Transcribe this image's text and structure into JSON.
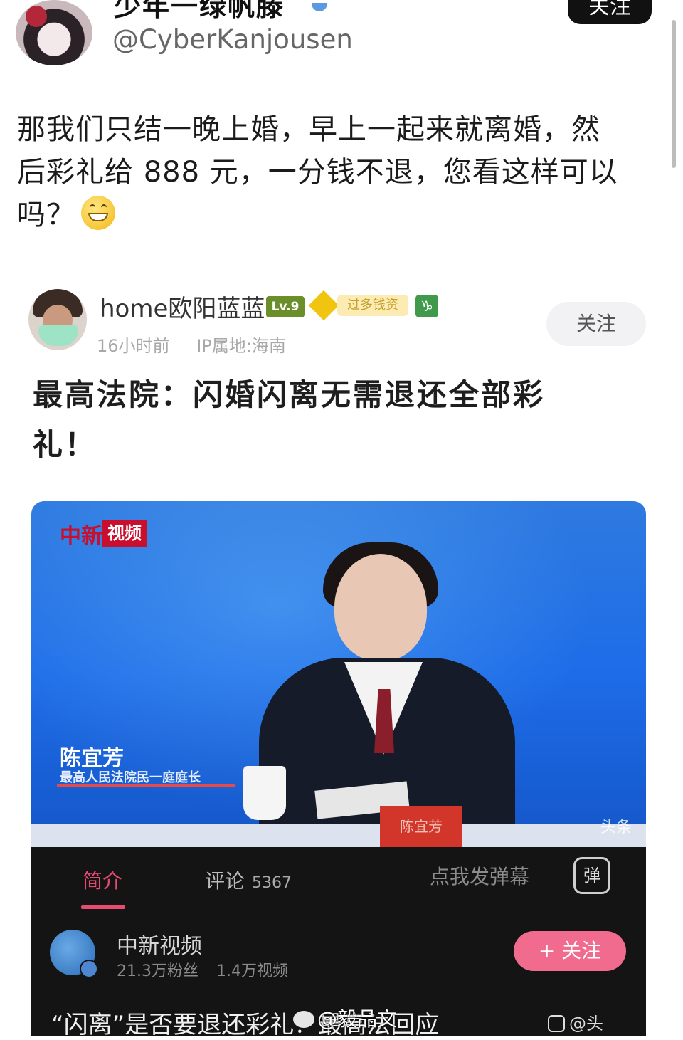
{
  "top_post": {
    "display_name": "少年一绿帆滕",
    "handle": "@CyberKanjousen",
    "follow_label": "关注",
    "text_lines": [
      "那我们只结一晚上婚，早上一起来就离婚，然",
      "后彩礼给 888 元，一分钱不退，您看这样可以",
      "吗？"
    ],
    "emoji": "grinning-face"
  },
  "quoted_post": {
    "username": "home欧阳蓝蓝",
    "level_badge": "Lv.9",
    "badge_text": "过多钱资",
    "zodiac_badge": "♑",
    "time": "16小时前",
    "ip": "IP属地:海南",
    "follow_label": "关注",
    "title_lines": [
      "最高法院：闪婚闪离无需退还全部彩",
      "礼！"
    ]
  },
  "video": {
    "logo_text": "中新",
    "logo_box": "视频",
    "speaker_name": "陈宜芳",
    "speaker_title": "最高人民法院民一庭庭长",
    "nameplate": "陈宜芳",
    "corner_mark": "头条"
  },
  "video_panel": {
    "tab_intro": "简介",
    "tab_comments": "评论",
    "comment_count": "5367",
    "danmaku_placeholder": "点我发弹幕",
    "danmaku_button": "弹",
    "channel_name": "中新视频",
    "fans": "21.3万粉丝",
    "videos": "1.4万视频",
    "follow_label": "+ 关注",
    "video_title": "“闪离”是否要退还彩礼？最高法回应"
  },
  "watermark": {
    "text": "@毅品文",
    "corner_text": "@头"
  },
  "colors": {
    "accent_pink": "#f06b8e",
    "video_blue": "#1e6ce8",
    "panel_dark": "#141414"
  }
}
